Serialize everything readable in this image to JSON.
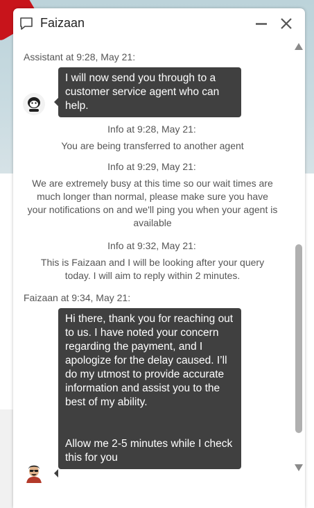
{
  "chat": {
    "title": "Faizaan"
  },
  "messages": {
    "assistant_sender": "Assistant at 9:28, May 21:",
    "assistant_text": "I will now send you through to a customer service agent who can help.",
    "info1_title": "Info at 9:28, May 21:",
    "info1_text": "You are being transferred to another agent",
    "info2_title": "Info at 9:29, May 21:",
    "info2_text": "We are extremely busy at this time so our wait times are much longer than normal, please make sure you have your notifications on and we'll ping you when your agent is available",
    "info3_title": "Info at 9:32, May 21:",
    "info3_text": "This is Faizaan and I will be looking after your query today. I will aim to reply within 2 minutes.",
    "agent_sender": "Faizaan at 9:34, May 21:",
    "agent_text_p1": "Hi there, thank you for reaching out to us. I have noted your concern regarding the payment, and I apologize for the delay caused. I’ll do my utmost to provide accurate information and assist you to the best of my ability.",
    "agent_text_p2": "Allow me 2-5 minutes while I check this for you"
  },
  "icons": {
    "chat": "chat-bubble-icon",
    "minimize": "minimize-icon",
    "close": "close-icon",
    "scroll_up": "triangle-up-icon",
    "scroll_down": "triangle-down-icon"
  },
  "colors": {
    "bubble_bg": "#404040",
    "bubble_text": "#ffffff",
    "meta_text": "#555555"
  }
}
